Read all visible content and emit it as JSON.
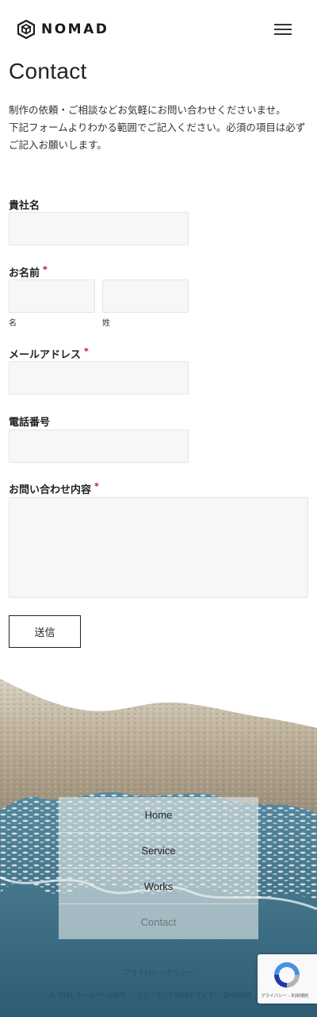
{
  "header": {
    "logo_text": "NOMAD",
    "logo_icon": "hexagon-cube-icon",
    "menu_icon": "hamburger-menu-icon"
  },
  "page": {
    "title": "Contact",
    "intro_line1": "制作の依頼・ご相談などお気軽にお問い合わせくださいませ。",
    "intro_line2": "下記フォームよりわかる範囲でご記入ください。必須の項目は必ずご記入お願いします。"
  },
  "form": {
    "required_mark": "*",
    "company_label": "貴社名",
    "name_label": "お名前",
    "first_name_sub": "名",
    "last_name_sub": "姓",
    "email_label": "メールアドレス",
    "phone_label": "電話番号",
    "message_label": "お問い合わせ内容",
    "submit_label": "送信"
  },
  "footer": {
    "nav": [
      "Home",
      "Service",
      "Works",
      "Contact"
    ],
    "current": "Contact",
    "privacy_link": "プライバシーポリシー",
    "copyright": "© 2021 ホームページ制作 ｜ フリーランスWEBデザイナー【NOMAD"
  },
  "recaptcha": {
    "text": "プライバシー - 利用規約",
    "icon": "recaptcha-icon"
  },
  "colors": {
    "accent_required": "#d0021b",
    "sand": "#c9bca6",
    "ocean": "#3d6f86"
  }
}
